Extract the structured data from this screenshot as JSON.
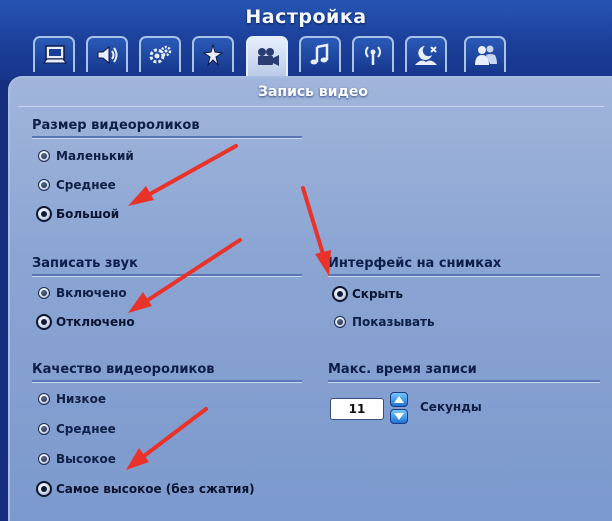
{
  "window": {
    "title": "Настройка"
  },
  "tabs": [
    {
      "icon": "monitor-icon",
      "active": false
    },
    {
      "icon": "speaker-icon",
      "active": false
    },
    {
      "icon": "gears-icon",
      "active": false
    },
    {
      "icon": "sparkle-icon",
      "active": false
    },
    {
      "icon": "video-camera-icon",
      "active": true
    },
    {
      "icon": "music-note-icon",
      "active": false
    },
    {
      "icon": "antenna-icon",
      "active": false
    },
    {
      "icon": "moon-landscape-icon",
      "active": false
    },
    {
      "icon": "people-icon",
      "active": false
    }
  ],
  "panel": {
    "title": "Запись видео",
    "video_size": {
      "title": "Размер видеороликов",
      "options": [
        "Маленький",
        "Среднее",
        "Большой"
      ],
      "selected": 2
    },
    "record_sound": {
      "title": "Записать звук",
      "options": [
        "Включено",
        "Отключено"
      ],
      "selected": 1
    },
    "video_quality": {
      "title": "Качество видеороликов",
      "options": [
        "Низкое",
        "Среднее",
        "Высокое",
        "Самое высокое (без сжатия)"
      ],
      "selected": 3
    },
    "screenshot_ui": {
      "title": "Интерфейс на снимках",
      "options": [
        "Скрыть",
        "Показывать"
      ],
      "selected": 0
    },
    "max_record_time": {
      "title": "Макс. время записи",
      "value": "11",
      "unit": "Секунды"
    }
  },
  "colors": {
    "arrow": "#e8322a",
    "background": "#152f7e",
    "panel": "#8ea8d6"
  }
}
